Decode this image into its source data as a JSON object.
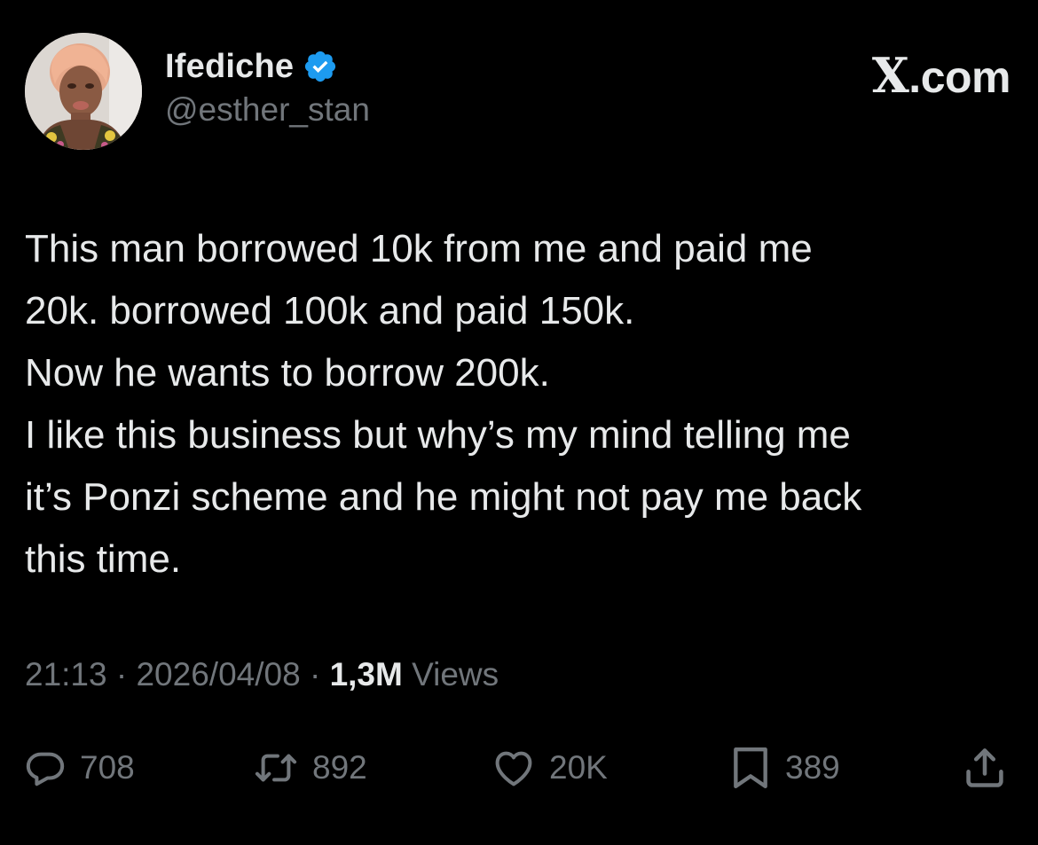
{
  "user": {
    "display_name": "Ifediche",
    "handle": "@esther_stan",
    "verified": true,
    "verified_color": "#1d9bf0"
  },
  "brand": {
    "glyph": "X",
    "suffix": ".com"
  },
  "tweet": {
    "lines": [
      "This man borrowed 10k from me and paid me",
      "20k. borrowed 100k and paid 150k.",
      "Now he wants to borrow 200k.",
      "I like this business but why’s my mind telling me",
      "it’s Ponzi scheme and he might not pay me back",
      "this time."
    ]
  },
  "meta": {
    "time": "21:13",
    "separator": " · ",
    "date": "2026/04/08",
    "views_count": "1,3M",
    "views_label": " Views"
  },
  "actions": {
    "replies": "708",
    "reposts": "892",
    "likes": "20K",
    "bookmarks": "389"
  },
  "icons": {
    "reply": "reply-icon",
    "repost": "repost-icon",
    "like": "heart-icon",
    "bookmark": "bookmark-icon",
    "share": "share-icon"
  },
  "colors": {
    "background": "#000000",
    "text": "#e7e9ea",
    "secondary": "#71767b",
    "accent": "#1d9bf0"
  }
}
